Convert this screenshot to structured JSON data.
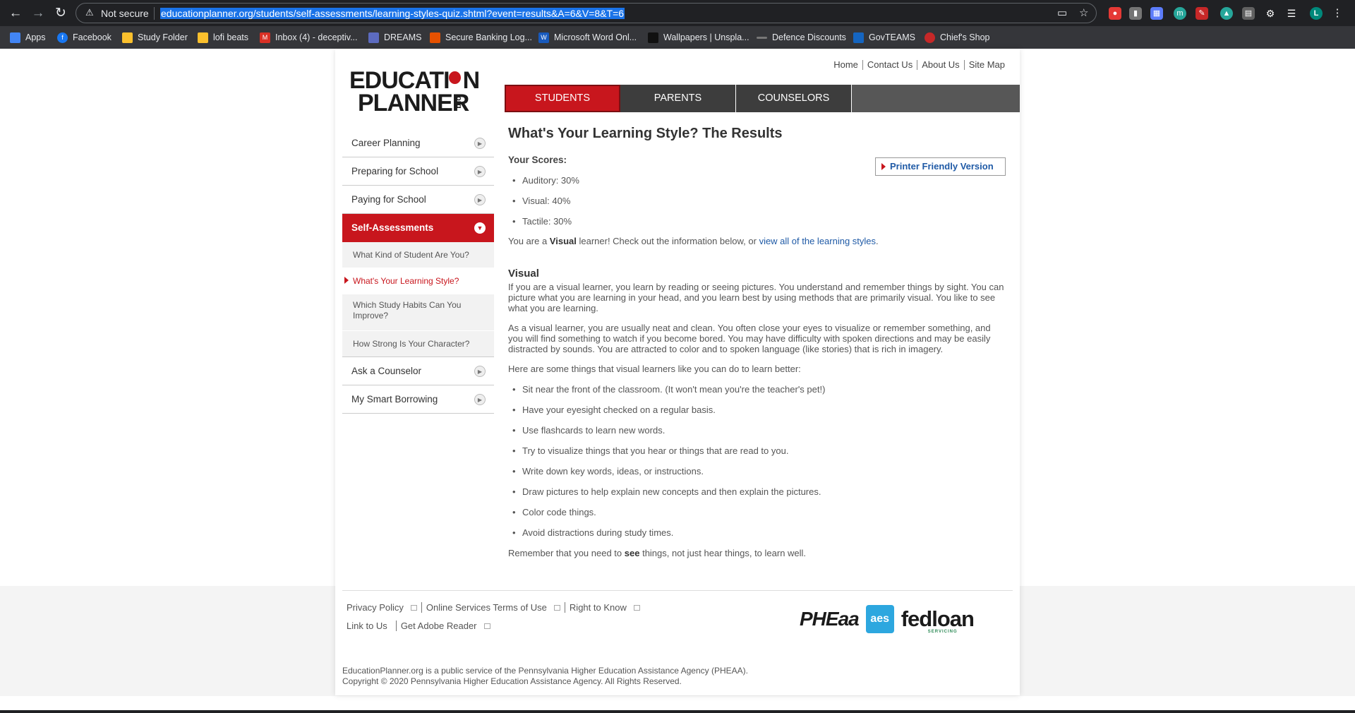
{
  "browser": {
    "security_label": "Not secure",
    "url": "educationplanner.org/students/self-assessments/learning-styles-quiz.shtml?event=results&A=6&V=8&T=6",
    "profile_initial": "L",
    "bookmarks": [
      {
        "label": "Apps",
        "color": "#4285f4"
      },
      {
        "label": "Facebook",
        "color": "#1877f2"
      },
      {
        "label": "Study Folder",
        "color": "#fbc02d"
      },
      {
        "label": "lofi beats",
        "color": "#fbc02d"
      },
      {
        "label": "Inbox (4) - deceptiv...",
        "color": "#d93025"
      },
      {
        "label": "DREAMS",
        "color": "#5c6bc0"
      },
      {
        "label": "Secure Banking Log...",
        "color": "#e65100"
      },
      {
        "label": "Microsoft Word Onl...",
        "color": "#185abd"
      },
      {
        "label": "Wallpapers | Unspla...",
        "color": "#111111"
      },
      {
        "label": "Defence Discounts",
        "color": "#777777"
      },
      {
        "label": "GovTEAMS",
        "color": "#1565c0"
      },
      {
        "label": "Chief's Shop",
        "color": "#c62828"
      }
    ]
  },
  "site": {
    "logo_line1": "EDUCATI",
    "logo_line1_end": "N",
    "logo_line2": "PLANNER",
    "logo_org": ".org",
    "top_links": [
      "Home",
      "Contact Us",
      "About Us",
      "Site Map"
    ],
    "tabs": [
      "STUDENTS",
      "PARENTS",
      "COUNSELORS"
    ]
  },
  "sidebar": {
    "items": [
      "Career Planning",
      "Preparing for School",
      "Paying for School"
    ],
    "active": "Self-Assessments",
    "sub": [
      "What Kind of Student Are You?",
      "What's Your Learning Style?",
      "Which Study Habits Can You Improve?",
      "How Strong Is Your Character?"
    ],
    "after": [
      "Ask a Counselor",
      "My Smart Borrowing"
    ]
  },
  "content": {
    "title": "What's Your Learning Style? The Results",
    "scores_heading": "Your Scores:",
    "printer": "Printer Friendly Version",
    "scores": [
      "Auditory: 30%",
      "Visual: 40%",
      "Tactile: 30%"
    ],
    "result_pre": "You are a ",
    "result_bold": "Visual",
    "result_mid": " learner! Check out the information below, or ",
    "result_link": "view all of the learning styles",
    "result_end": ".",
    "section_title": "Visual",
    "para1": "If you are a visual learner, you learn by reading or seeing pictures. You understand and remember things by sight. You can picture what you are learning in your head, and you learn best by using methods that are primarily visual. You like to see what you are learning.",
    "para2": "As a visual learner, you are usually neat and clean. You often close your eyes to visualize or remember something, and you will find something to watch if you become bored. You may have difficulty with spoken directions and may be easily distracted by sounds. You are attracted to color and to spoken language (like stories) that is rich in imagery.",
    "para3": "Here are some things that visual learners like you can do to learn better:",
    "tips": [
      "Sit near the front of the classroom. (It won't mean you're the teacher's pet!)",
      "Have your eyesight checked on a regular basis.",
      "Use flashcards to learn new words.",
      "Try to visualize things that you hear or things that are read to you.",
      "Write down key words, ideas, or instructions.",
      "Draw pictures to help explain new concepts and then explain the pictures.",
      "Color code things.",
      "Avoid distractions during study times."
    ],
    "closing_pre": "Remember that you need to ",
    "closing_bold": "see",
    "closing_end": " things, not just hear things, to learn well."
  },
  "footer": {
    "row1": [
      "Privacy Policy",
      "Online Services Terms of Use",
      "Right to Know"
    ],
    "row2": [
      "Link to Us",
      "Get Adobe Reader"
    ],
    "logo_pheaa": "PHEaa",
    "logo_aes": "aes",
    "logo_fed": "fedloan",
    "logo_fed_sub": "SERVICING",
    "copy1": "EducationPlanner.org is a public service of the Pennsylvania Higher Education Assistance Agency (PHEAA).",
    "copy2": "Copyright © 2020 Pennsylvania Higher Education Assistance Agency. All Rights Reserved."
  }
}
